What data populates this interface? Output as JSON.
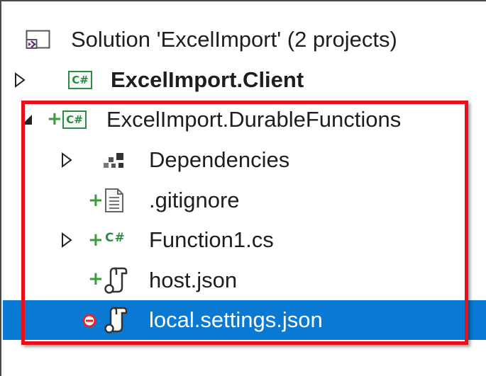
{
  "tree": {
    "items": [
      {
        "label": "Solution 'ExcelImport' (2 projects)",
        "icon": "vs-solution-icon"
      },
      {
        "label": "ExcelImport.Client",
        "icon": "csharp-project-icon",
        "expander": "collapsed"
      },
      {
        "label": "ExcelImport.DurableFunctions",
        "icon": "csharp-project-icon",
        "expander": "expanded"
      },
      {
        "label": "Dependencies",
        "icon": "dependencies-icon",
        "expander": "collapsed"
      },
      {
        "label": ".gitignore",
        "icon": "text-file-icon"
      },
      {
        "label": "Function1.cs",
        "icon": "csharp-file-icon",
        "expander": "collapsed"
      },
      {
        "label": "host.json",
        "icon": "json-file-icon"
      },
      {
        "label": "local.settings.json",
        "icon": "json-file-icon",
        "selected": true
      }
    ],
    "glyphs": {
      "csharp_box": "C#",
      "csharp_plain": "C#",
      "added": "+"
    }
  },
  "colors": {
    "selection": "#0a79d4",
    "highlight_border": "#e8101a",
    "added_green": "#3a9b3a",
    "excluded_red": "#e0262b"
  }
}
